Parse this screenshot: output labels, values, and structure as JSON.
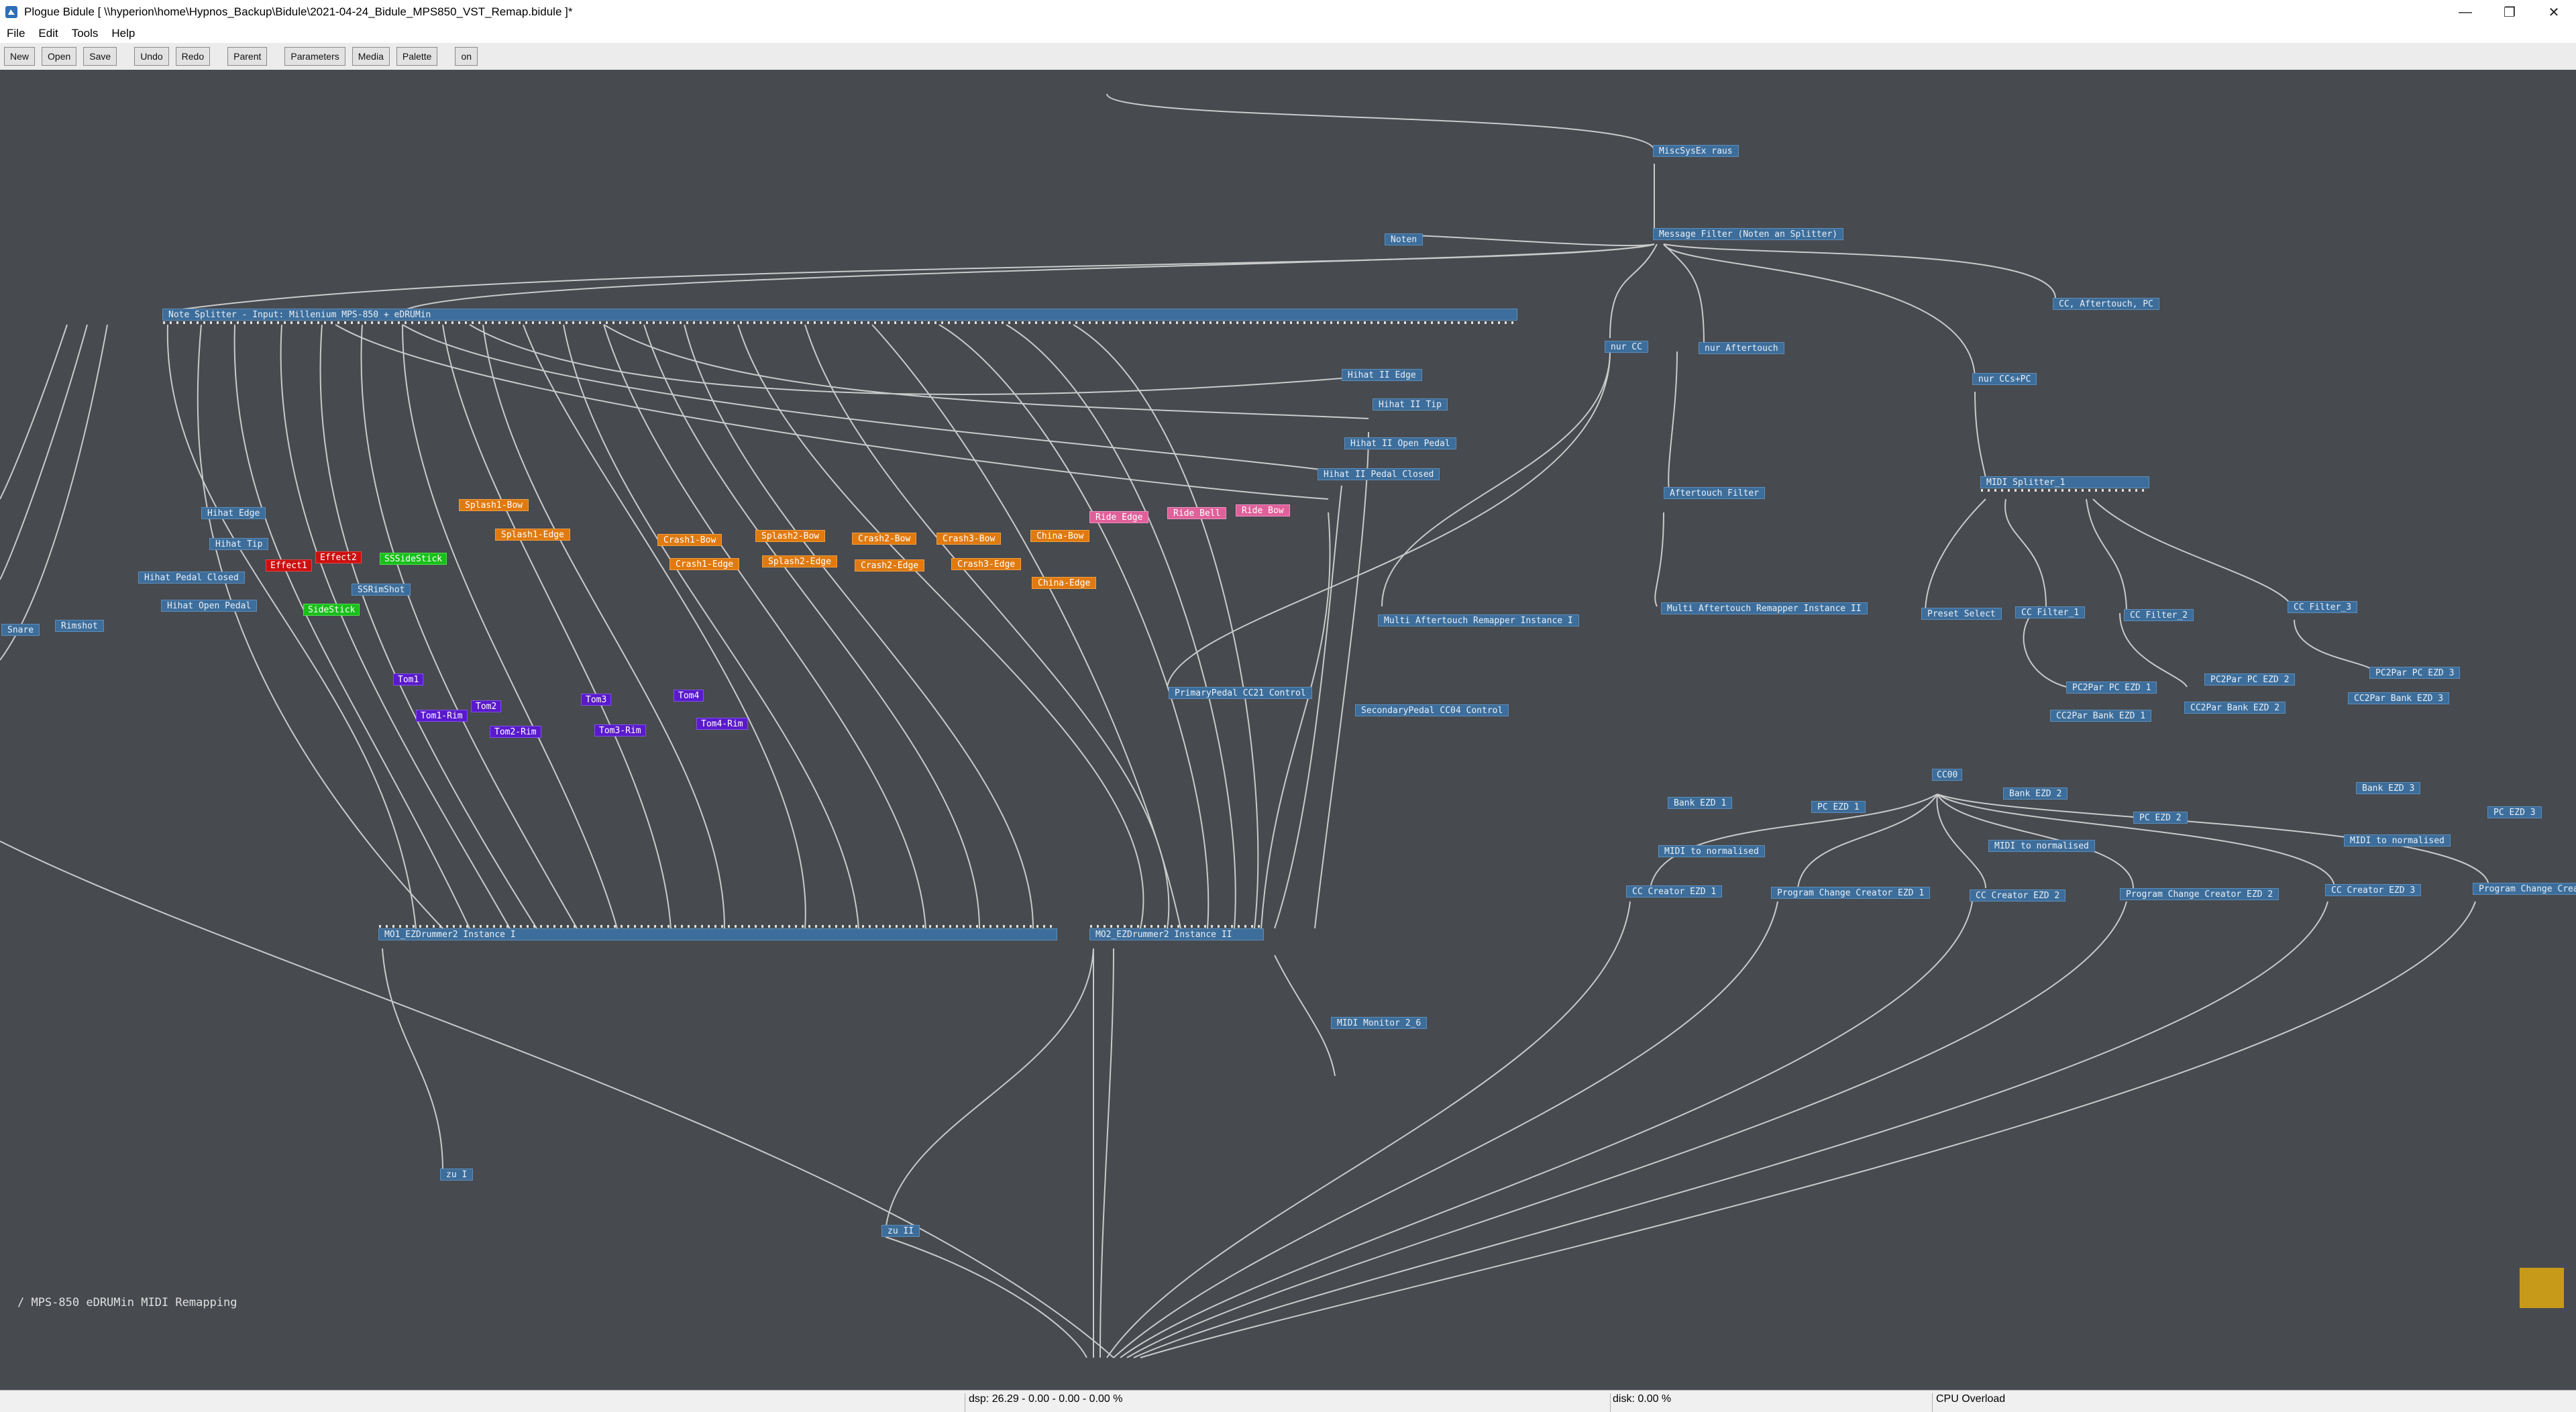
{
  "window": {
    "title": "Plogue Bidule [ \\\\hyperion\\home\\Hypnos_Backup\\Bidule\\2021-04-24_Bidule_MPS850_VST_Remap.bidule ]*",
    "minimize": "—",
    "maximize": "❐",
    "close": "✕"
  },
  "menu": [
    "File",
    "Edit",
    "Tools",
    "Help"
  ],
  "toolbar": {
    "new": "New",
    "open": "Open",
    "save": "Save",
    "undo": "Undo",
    "redo": "Redo",
    "parent": "Parent",
    "parameters": "Parameters",
    "media": "Media",
    "palette": "Palette",
    "on": "on"
  },
  "canvas_path": "/ MPS-850 eDRUMin MIDI Remapping",
  "status": {
    "dsp": "dsp: 26.29 -  0.00 -  0.00 -  0.00 %",
    "disk": "disk:  0.00 %",
    "cpu": "CPU Overload"
  },
  "colors": {
    "canvas": "#474a4f",
    "node": "#3d6e9b",
    "orange": "#e07a10",
    "red": "#cc1010",
    "green": "#18c018",
    "purple": "#5a1acc",
    "pink": "#e0609a",
    "wire": "#d8d8d8"
  },
  "nodes": {
    "misc_sysex": "MiscSysEx raus",
    "message_filter": "Message Filter (Noten an Splitter)",
    "noten": "Noten",
    "cc_aftertouch_pc": "CC, Aftertouch, PC",
    "note_splitter": "Note Splitter - Input: Millenium MPS-850 + eDRUMin",
    "nur_cc": "nur CC",
    "nur_aftertouch": "nur Aftertouch",
    "nur_cc_pc": "nur CCs+PC",
    "hihat2_edge": "Hihat II Edge",
    "hihat2_tip": "Hihat II Tip",
    "hihat2_open": "Hihat II Open Pedal",
    "hihat2_closed": "Hihat II Pedal Closed",
    "aftertouch_filter": "Aftertouch Filter",
    "midi_splitter_1": "MIDI Splitter_1",
    "hihat_edge": "Hihat Edge",
    "hihat_tip": "Hihat Tip",
    "hihat_pedal_closed": "Hihat Pedal Closed",
    "hihat_open_pedal": "Hihat Open Pedal",
    "snare": "Snare",
    "rimshot": "Rimshot",
    "splash1_bow": "Splash1-Bow",
    "splash1_edge": "Splash1-Edge",
    "effect1": "Effect1",
    "effect2": "Effect2",
    "ss_sidestick": "SSSideStick",
    "ss_rimshot": "SSRimShot",
    "sidestick": "SideStick",
    "crash1_bow": "Crash1-Bow",
    "crash1_edge": "Crash1-Edge",
    "splash2_bow": "Splash2-Bow",
    "splash2_edge": "Splash2-Edge",
    "crash2_bow": "Crash2-Bow",
    "crash2_edge": "Crash2-Edge",
    "crash3_bow": "Crash3-Bow",
    "crash3_edge": "Crash3-Edge",
    "china_bow": "China-Bow",
    "china_edge": "China-Edge",
    "ride_edge": "Ride Edge",
    "ride_bell": "Ride Bell",
    "ride_bow": "Ride Bow",
    "multi_at_1": "Multi Aftertouch Remapper Instance I",
    "multi_at_2": "Multi Aftertouch Remapper Instance II",
    "preset_select": "Preset Select",
    "cc_filter_1": "CC Filter_1",
    "cc_filter_2": "CC Filter_2",
    "cc_filter_3": "CC Filter_3",
    "pc2par_pc_ezd1": "PC2Par PC EZD 1",
    "cc2par_bank_ezd1": "CC2Par Bank EZD 1",
    "pc2par_pc_ezd2": "PC2Par PC EZD 2",
    "cc2par_bank_ezd2": "CC2Par Bank EZD 2",
    "pc2par_pc_ezd3": "PC2Par PC EZD 3",
    "cc2par_bank_ezd3": "CC2Par Bank EZD 3",
    "tom1": "Tom1",
    "tom1_rim": "Tom1-Rim",
    "tom2": "Tom2",
    "tom2_rim": "Tom2-Rim",
    "tom3": "Tom3",
    "tom3_rim": "Tom3-Rim",
    "tom4": "Tom4",
    "tom4_rim": "Tom4-Rim",
    "primary_pedal": "PrimaryPedal CC21 Control",
    "secondary_pedal": "SecondaryPedal CC04 Control",
    "cc00": "CC00",
    "bank_ezd1": "Bank EZD 1",
    "pc_ezd1": "PC EZD 1",
    "bank_ezd2": "Bank EZD 2",
    "pc_ezd2": "PC EZD 2",
    "bank_ezd3": "Bank EZD 3",
    "pc_ezd3": "PC EZD 3",
    "midi_norm_1": "MIDI to normalised",
    "midi_norm_2": "MIDI to normalised",
    "midi_norm_3": "MIDI to normalised",
    "cc_creator_1": "CC Creator EZD 1",
    "pcc_1": "Program Change Creator EZD 1",
    "cc_creator_2": "CC Creator EZD 2",
    "pcc_2": "Program Change Creator EZD 2",
    "cc_creator_3": "CC Creator EZD 3",
    "pcc_3": "Program Change Creat",
    "ezd1": "MO1_EZDrummer2 Instance I",
    "ezd2": "MO2_EZDrummer2 Instance II",
    "midi_monitor": "MIDI Monitor 2_6",
    "zu_1": "zu I",
    "zu_2": "zu II"
  }
}
